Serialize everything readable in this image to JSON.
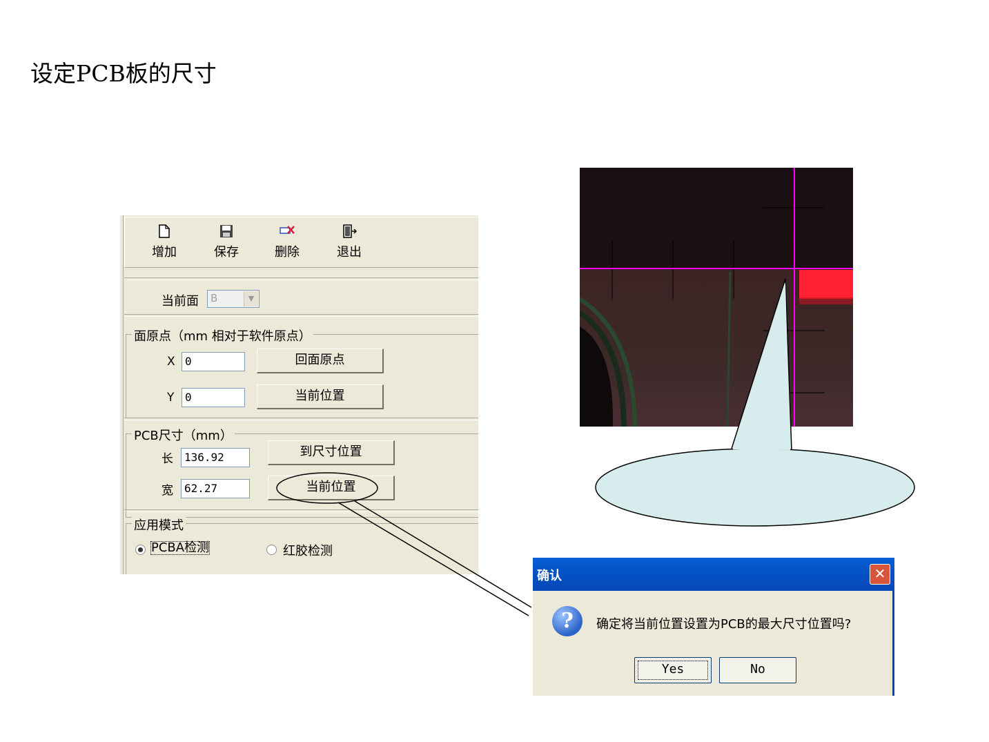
{
  "slide_title": "设定PCB板的尺寸",
  "toolbar": [
    {
      "label": "增加",
      "icon": "new-file-icon"
    },
    {
      "label": "保存",
      "icon": "save-disk-icon"
    },
    {
      "label": "删除",
      "icon": "delete-icon"
    },
    {
      "label": "退出",
      "icon": "exit-door-icon"
    }
  ],
  "face": {
    "label": "当前面",
    "value": "B"
  },
  "origin_group": {
    "legend": "面原点（mm 相对于软件原点）",
    "x_label": "X",
    "x_value": "0",
    "y_label": "Y",
    "y_value": "0",
    "btn_return_origin": "回面原点",
    "btn_current_pos": "当前位置"
  },
  "size_group": {
    "legend": "PCB尺寸（mm）",
    "length_label": "长",
    "length_value": "136.92",
    "width_label": "宽",
    "width_value": "62.27",
    "btn_goto_size": "到尺寸位置",
    "btn_current_pos": "当前位置"
  },
  "mode_group": {
    "legend": "应用模式",
    "option_pcba": "PCBA检测",
    "option_glue": "红胶检测",
    "selected": "PCBA检测"
  },
  "dialog": {
    "title": "确认",
    "message": "确定将当前位置设置为PCB的最大尺寸位置吗?",
    "yes": "Yes",
    "no": "No"
  },
  "colors": {
    "crosshair": "#ff00ff",
    "callout_fill": "#d7ecec",
    "dialog_title": "#0453c6"
  }
}
